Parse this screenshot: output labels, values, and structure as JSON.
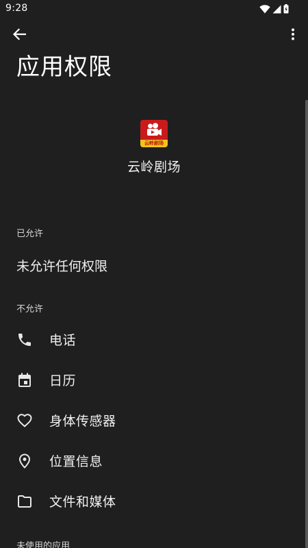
{
  "status_bar": {
    "time": "9:28",
    "icons": [
      "wifi-icon",
      "signal-icon",
      "battery-icon"
    ]
  },
  "app_bar": {
    "back_icon": "arrow-back-icon",
    "more_icon": "more-vert-icon"
  },
  "page": {
    "title": "应用权限"
  },
  "app": {
    "name": "云岭剧场",
    "icon_caption": "云岭剧场",
    "icon_colors": {
      "background": "#c91b1b",
      "band": "#f2c318"
    }
  },
  "allowed": {
    "label": "已允许",
    "empty_text": "未允许任何权限"
  },
  "not_allowed": {
    "label": "不允许",
    "items": [
      {
        "label": "电话",
        "icon": "phone-icon"
      },
      {
        "label": "日历",
        "icon": "calendar-icon"
      },
      {
        "label": "身体传感器",
        "icon": "heart-icon"
      },
      {
        "label": "位置信息",
        "icon": "location-pin-icon"
      },
      {
        "label": "文件和媒体",
        "icon": "folder-icon"
      }
    ]
  },
  "unused_apps": {
    "label": "未使用的应用"
  }
}
